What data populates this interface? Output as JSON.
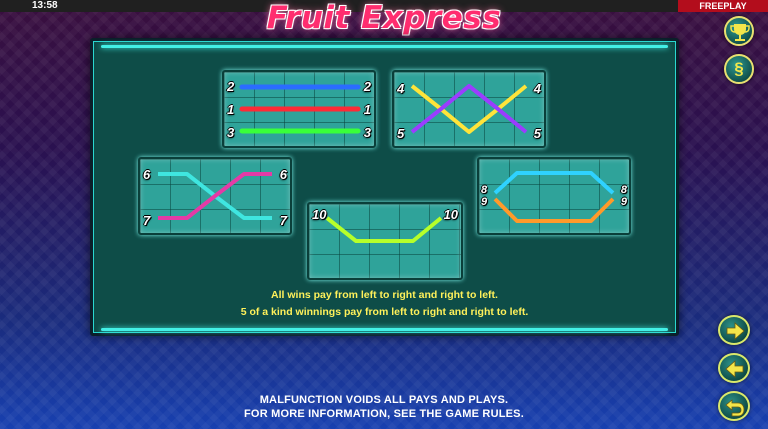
{
  "status_bar": {
    "time": "13:58",
    "mode": "FREEPLAY"
  },
  "game": {
    "title": "Fruit Express"
  },
  "paylines": [
    {
      "label": "2",
      "color": "#2b6cff"
    },
    {
      "label": "1",
      "color": "#ff2a36"
    },
    {
      "label": "3",
      "color": "#39ff3a"
    },
    {
      "label": "4",
      "color": "#ffe43a"
    },
    {
      "label": "5",
      "color": "#9b3cff"
    },
    {
      "label": "6",
      "color": "#3fe6e0"
    },
    {
      "label": "7",
      "color": "#e43aa6"
    },
    {
      "label": "8",
      "color": "#2fd2ff"
    },
    {
      "label": "9",
      "color": "#ff9a2a"
    },
    {
      "label": "10",
      "color": "#b6ff2a"
    }
  ],
  "info": {
    "line1": "All wins pay from left to right and right to left.",
    "line2": "5 of a kind winnings pay from left to right and right to left."
  },
  "footer": {
    "line1": "MALFUNCTION VOIDS ALL PAYS AND PLAYS.",
    "line2": "FOR MORE INFORMATION, SEE THE GAME RULES."
  },
  "buttons": {
    "paytable_icon": "trophy-icon",
    "rules_icon": "section-sign-icon",
    "rules_glyph": "§",
    "next_icon": "arrow-right-icon",
    "prev_icon": "arrow-left-icon",
    "return_icon": "return-arrow-icon"
  }
}
